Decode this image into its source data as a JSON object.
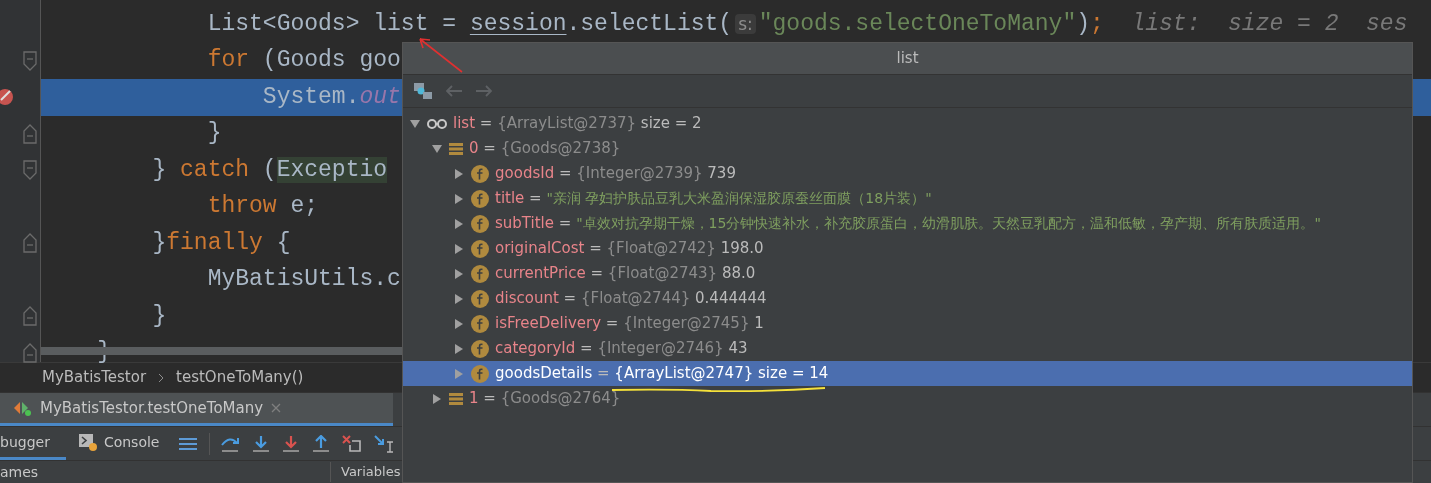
{
  "editor": {
    "lines": [
      {
        "highlighted": false,
        "tokens": [
          {
            "kind": "plain",
            "text": "            List<Goods> list = "
          },
          {
            "kind": "underlined",
            "text": "session"
          },
          {
            "kind": "plain",
            "text": ".selectList("
          },
          {
            "kind": "hint",
            "text": "s:"
          },
          {
            "kind": "string",
            "text": "\"goods.selectOneToMany\""
          },
          {
            "kind": "plain",
            "text": ")"
          },
          {
            "kind": "keyword",
            "text": ";"
          },
          {
            "kind": "inline",
            "text": "  list:  size = 2  ses"
          }
        ]
      },
      {
        "gutter": {
          "kind": "fold_start"
        },
        "highlighted": false,
        "tokens": [
          {
            "kind": "keyword",
            "text": "            for"
          },
          {
            "kind": "plain",
            "text": " (Goods goo"
          }
        ]
      },
      {
        "gutter": {
          "kind": "breakpoint"
        },
        "highlighted": true,
        "tokens": [
          {
            "kind": "plain",
            "text": "                System."
          },
          {
            "kind": "field",
            "text": "out"
          }
        ]
      },
      {
        "gutter": {
          "kind": "fold_end"
        },
        "highlighted": false,
        "tokens": [
          {
            "kind": "plain",
            "text": "            }"
          }
        ]
      },
      {
        "gutter": {
          "kind": "fold_start"
        },
        "highlighted": false,
        "tokens": [
          {
            "kind": "plain",
            "text": "        } "
          },
          {
            "kind": "keyword",
            "text": "catch"
          },
          {
            "kind": "plain",
            "text": " ("
          },
          {
            "kind": "marked",
            "text": "Exceptio"
          }
        ]
      },
      {
        "highlighted": false,
        "tokens": [
          {
            "kind": "keyword",
            "text": "            throw"
          },
          {
            "kind": "plain",
            "text": " e;"
          }
        ]
      },
      {
        "gutter": {
          "kind": "fold_end"
        },
        "highlighted": false,
        "tokens": [
          {
            "kind": "plain",
            "text": "        }"
          },
          {
            "kind": "keyword",
            "text": "finally"
          },
          {
            "kind": "plain",
            "text": " {"
          }
        ]
      },
      {
        "highlighted": false,
        "tokens": [
          {
            "kind": "plain",
            "text": "            MyBatisUtils.c"
          }
        ]
      },
      {
        "gutter": {
          "kind": "fold_end"
        },
        "highlighted": false,
        "tokens": [
          {
            "kind": "plain",
            "text": "        }"
          }
        ]
      },
      {
        "gutter": {
          "kind": "fold_end"
        },
        "highlighted": false,
        "tokens": [
          {
            "kind": "plain",
            "text": "    }"
          }
        ]
      }
    ]
  },
  "breadcrumb": [
    "MyBatisTestor",
    "testOneToMany()"
  ],
  "run_tabs": [
    {
      "label": "MyBatisTestor.testOneToMany",
      "selected": true
    }
  ],
  "debug_tabs": [
    {
      "label": "bugger",
      "selected": true
    },
    {
      "label": "Console",
      "selected": false,
      "kind": "console"
    }
  ],
  "panes": [
    "ames",
    "Variables"
  ],
  "popup": {
    "title": "list",
    "tree": [
      {
        "kind": "watch",
        "name": "list",
        "sign": "=",
        "ref": "{ArrayList@2737}",
        "value": "size = 2",
        "expanded": true,
        "selected": false,
        "children": [
          {
            "kind": "element",
            "name": "0",
            "sign": "=",
            "ref": "{Goods@2738}",
            "expanded": true,
            "selected": false,
            "children": [
              {
                "kind": "field",
                "name": "goodsId",
                "sign": "=",
                "ref": "{Integer@2739}",
                "value": "739",
                "expanded": false,
                "selected": false
              },
              {
                "kind": "field",
                "name": "title",
                "sign": "=",
                "text": "\"亲润 孕妇护肤品豆乳大米盈润保湿胶原蚕丝面膜（18片装）\"",
                "expanded": false,
                "selected": false
              },
              {
                "kind": "field",
                "name": "subTitle",
                "sign": "=",
                "text": "\"卓效对抗孕期干燥，15分钟快速补水，补充胶原蛋白，幼滑肌肤。天然豆乳配方，温和低敏，孕产期、所有肤质适用。\"",
                "expanded": false,
                "selected": false
              },
              {
                "kind": "field",
                "name": "originalCost",
                "sign": "=",
                "ref": "{Float@2742}",
                "value": "198.0",
                "expanded": false,
                "selected": false
              },
              {
                "kind": "field",
                "name": "currentPrice",
                "sign": "=",
                "ref": "{Float@2743}",
                "value": "88.0",
                "expanded": false,
                "selected": false
              },
              {
                "kind": "field",
                "name": "discount",
                "sign": "=",
                "ref": "{Float@2744}",
                "value": "0.444444",
                "expanded": false,
                "selected": false
              },
              {
                "kind": "field",
                "name": "isFreeDelivery",
                "sign": "=",
                "ref": "{Integer@2745}",
                "value": "1",
                "expanded": false,
                "selected": false
              },
              {
                "kind": "field",
                "name": "categoryId",
                "sign": "=",
                "ref": "{Integer@2746}",
                "value": "43",
                "expanded": false,
                "selected": false
              },
              {
                "kind": "field",
                "name": "goodsDetails",
                "sign": "=",
                "ref": "{ArrayList@2747}",
                "value": "size = 14",
                "expanded": false,
                "selected": true
              }
            ]
          },
          {
            "kind": "element",
            "name": "1",
            "sign": "=",
            "ref": "{Goods@2764}",
            "expanded": false,
            "selected": false
          }
        ]
      }
    ]
  }
}
